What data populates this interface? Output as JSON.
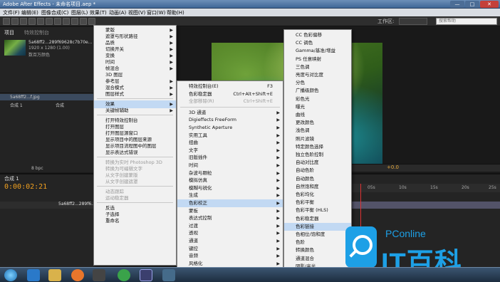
{
  "window": {
    "title": "Adobe After Effects - 未命名项目.aep *"
  },
  "menubar": [
    "文件(F)",
    "编辑(E)",
    "图像合成(C)",
    "图层(L)",
    "效果(T)",
    "动画(A)",
    "视图(V)",
    "窗口(W)",
    "帮助(H)"
  ],
  "toolbar": {
    "workspace_label": "工作区:",
    "help_placeholder": "搜索帮助"
  },
  "project": {
    "tab": "项目",
    "tab2": "特效控制台",
    "footage_name": "5a68ff2...289f69628c7b70e...",
    "info1": "1920 x 1280 (1.00)",
    "info2": "数百万颜色",
    "items": [
      {
        "name": "5a68ff2...f.jpg",
        "selected": true
      },
      {
        "name": "合成 1",
        "type": "合成",
        "selected": false
      }
    ],
    "bpc": "8 bpc"
  },
  "viewer": {
    "offset": "+0.0"
  },
  "timeline": {
    "tab": "合成 1",
    "timecode": "0:00:02:21",
    "layer_name": "5a68ff2...289f6...",
    "ruler": [
      "05s",
      "10s",
      "15s",
      "20s",
      "25s"
    ]
  },
  "context_menu": {
    "items": [
      {
        "label": "蒙版",
        "sub": true
      },
      {
        "label": "遮罩与形状路径",
        "sub": true
      },
      {
        "label": "品质",
        "sub": true
      },
      {
        "label": "切换开关",
        "sub": true
      },
      {
        "label": "变换",
        "sub": true
      },
      {
        "label": "时间",
        "sub": true
      },
      {
        "label": "帧混合",
        "sub": true
      },
      {
        "label": "3D 图层"
      },
      {
        "label": "参考层",
        "sub": true
      },
      {
        "label": "混合模式",
        "sub": true
      },
      {
        "label": "图层样式",
        "sub": true
      },
      {
        "sep": true
      },
      {
        "label": "效果",
        "sub": true,
        "hl": true
      },
      {
        "label": "关键帧辅助",
        "sub": true
      },
      {
        "sep": true
      },
      {
        "label": "打开特效控制台"
      },
      {
        "label": "打开图层"
      },
      {
        "label": "打开图层源窗口"
      },
      {
        "label": "显示项目中的图层来源"
      },
      {
        "label": "显示项目流程图中的图层"
      },
      {
        "label": "显示表达式错误"
      },
      {
        "sep": true
      },
      {
        "label": "转换为实时 Photoshop 3D",
        "dis": true
      },
      {
        "label": "转换为可编辑文字",
        "dis": true
      },
      {
        "label": "从文字创建蒙版",
        "dis": true
      },
      {
        "label": "从文字创建遮罩",
        "dis": true
      },
      {
        "sep": true
      },
      {
        "label": "动态跟踪",
        "dis": true
      },
      {
        "label": "运动稳定器",
        "dis": true
      },
      {
        "sep": true
      },
      {
        "label": "反选"
      },
      {
        "label": "子选择"
      },
      {
        "label": "重命名"
      }
    ]
  },
  "effects_menu": {
    "items": [
      {
        "label": "特效控制台(E)",
        "sc": "F3"
      },
      {
        "label": "色彩稳定器",
        "sc": "Ctrl+Alt+Shift+E"
      },
      {
        "label": "全部移除(R)",
        "sc": "Ctrl+Shift+E",
        "dis": true
      },
      {
        "sep": true
      },
      {
        "label": "3D 通道",
        "sub": true
      },
      {
        "label": "Digieffects FreeForm",
        "sub": true
      },
      {
        "label": "Synthetic Aperture",
        "sub": true
      },
      {
        "label": "实用工具",
        "sub": true
      },
      {
        "label": "扭曲",
        "sub": true
      },
      {
        "label": "文字",
        "sub": true
      },
      {
        "label": "旧版插件",
        "sub": true
      },
      {
        "label": "时间",
        "sub": true
      },
      {
        "label": "杂波与颗粒",
        "sub": true
      },
      {
        "label": "模拟仿真",
        "sub": true
      },
      {
        "label": "模糊与锐化",
        "sub": true
      },
      {
        "label": "生成",
        "sub": true
      },
      {
        "label": "色彩校正",
        "sub": true,
        "hl": true
      },
      {
        "label": "蒙板",
        "sub": true
      },
      {
        "label": "表达式控制",
        "sub": true
      },
      {
        "label": "过渡",
        "sub": true
      },
      {
        "label": "透视",
        "sub": true
      },
      {
        "label": "通道",
        "sub": true
      },
      {
        "label": "键控",
        "sub": true
      },
      {
        "label": "音频",
        "sub": true
      },
      {
        "label": "风格化",
        "sub": true
      }
    ]
  },
  "color_menu": {
    "items": [
      {
        "label": "CC 色彩偏移"
      },
      {
        "label": "CC 调色"
      },
      {
        "label": "Gamma/基准/增益"
      },
      {
        "label": "PS 任意映射"
      },
      {
        "label": "三色调"
      },
      {
        "label": "亮度与对比度"
      },
      {
        "label": "分色"
      },
      {
        "label": "广播级颜色"
      },
      {
        "label": "彩色光"
      },
      {
        "label": "曝光"
      },
      {
        "label": "曲线"
      },
      {
        "label": "更改颜色"
      },
      {
        "label": "浅色调"
      },
      {
        "label": "照片滤镜"
      },
      {
        "label": "特定颜色选择"
      },
      {
        "label": "独立色阶控制"
      },
      {
        "label": "自动对比度"
      },
      {
        "label": "自动色阶"
      },
      {
        "label": "自动颜色"
      },
      {
        "label": "自然饱和度"
      },
      {
        "label": "色彩均化"
      },
      {
        "label": "色彩平衡"
      },
      {
        "label": "色彩平衡 (HLS)"
      },
      {
        "label": "色彩稳定器"
      },
      {
        "label": "色彩链接",
        "hl": true
      },
      {
        "label": "色相位/饱和度"
      },
      {
        "label": "色阶"
      },
      {
        "label": "转换颜色"
      },
      {
        "label": "通道混合"
      },
      {
        "label": "阴影/高光"
      },
      {
        "label": "黑白"
      }
    ]
  },
  "watermark": {
    "brand": "PConline",
    "big": "IT百科"
  }
}
